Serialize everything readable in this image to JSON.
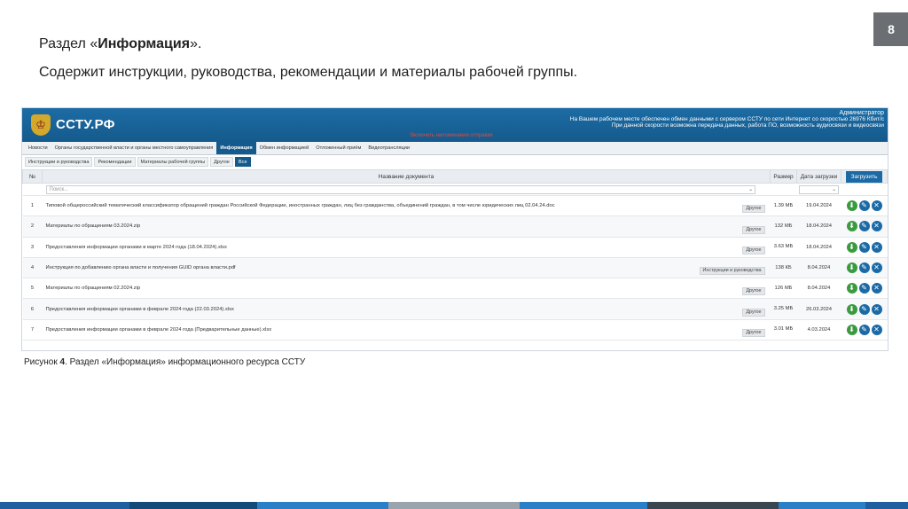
{
  "page_number": "8",
  "slide": {
    "title_prefix": "Раздел «",
    "title_bold": "Информация",
    "title_suffix": "».",
    "subtitle": "Содержит инструкции, руководства, рекомендации и материалы рабочей группы."
  },
  "site": {
    "logo": "ССТУ.РФ",
    "alert": "Включить напоминания отправки",
    "admin_name": "Администратор",
    "speed_line1": "На Вашем рабочем месте обеспечен обмен данными с сервером ССТУ по сети Интернет со скоростью 26976 Кбит/с",
    "speed_line2": "При данной скорости возможна передача данных, работа ПО, возможность аудиосвязи и видеосвязи"
  },
  "nav": [
    {
      "label": "Новости",
      "active": false
    },
    {
      "label": "Органы государственной власти и органы местного самоуправления",
      "active": false
    },
    {
      "label": "Информация",
      "active": true
    },
    {
      "label": "Обмен информацией",
      "active": false
    },
    {
      "label": "Отложенный приём",
      "active": false
    },
    {
      "label": "Видеотрансляции",
      "active": false
    }
  ],
  "subtabs": [
    {
      "label": "Инструкции и руководства",
      "active": false
    },
    {
      "label": "Рекомендации",
      "active": false
    },
    {
      "label": "Материалы рабочей группы",
      "active": false
    },
    {
      "label": "Другое",
      "active": false
    },
    {
      "label": "Все",
      "active": true
    }
  ],
  "table": {
    "headers": {
      "num": "№",
      "name": "Название документа",
      "size": "Размер",
      "date": "Дата загрузки",
      "upload": "Загрузить"
    },
    "search_placeholder": "Поиск...",
    "rows": [
      {
        "num": "1",
        "name": "Типовой общероссийский тематический классификатор обращений граждан Российской Федерации, иностранных граждан, лиц без гражданства, объединений граждан, в том числе юридических лиц 02.04.24.doc",
        "tag": "Другое",
        "size": "1.39 МБ",
        "date": "19.04.2024"
      },
      {
        "num": "2",
        "name": "Материалы по обращениям 03.2024.zip",
        "tag": "Другое",
        "size": "132 МБ",
        "date": "18.04.2024"
      },
      {
        "num": "3",
        "name": "Предоставления информации органами в марте 2024 года (18.04.2024).xlsx",
        "tag": "Другое",
        "size": "3.63 МБ",
        "date": "18.04.2024"
      },
      {
        "num": "4",
        "name": "Инструкция по добавлению органа власти и получения GUID органа власти.pdf",
        "tag": "Инструкции и руководства",
        "size": "138 КБ",
        "date": "8.04.2024"
      },
      {
        "num": "5",
        "name": "Материалы по обращениям 02.2024.zip",
        "tag": "Другое",
        "size": "126 МБ",
        "date": "8.04.2024"
      },
      {
        "num": "6",
        "name": "Предоставления информации органами в феврале 2024 года (22.03.2024).xlsx",
        "tag": "Другое",
        "size": "3.25 МБ",
        "date": "26.03.2024"
      },
      {
        "num": "7",
        "name": "Предоставления информации органами в феврале 2024 года (Предварительные данные).xlsx",
        "tag": "Другое",
        "size": "3.01 МБ",
        "date": "4.03.2024"
      }
    ]
  },
  "caption": {
    "prefix": "Рисунок ",
    "number": "4",
    "text": ". Раздел «Информация» информационного ресурса ССТУ"
  },
  "icons": {
    "download": "download-icon",
    "edit": "edit-icon",
    "delete": "delete-icon",
    "emblem": "coat-of-arms-icon"
  },
  "colors": {
    "header_blue": "#155a8c",
    "accent_blue": "#1b6aa6",
    "download_green": "#3a9a3e",
    "alert_red": "#e04a3b",
    "badge_gray": "#6b6e72"
  },
  "bottom_bar_colors": [
    "#1f5fa0",
    "#134a7a",
    "#2a7fc6",
    "#9aa4ad",
    "#2a7fc6",
    "#3a4650",
    "#2a7fc6",
    "#1f5fa0"
  ]
}
